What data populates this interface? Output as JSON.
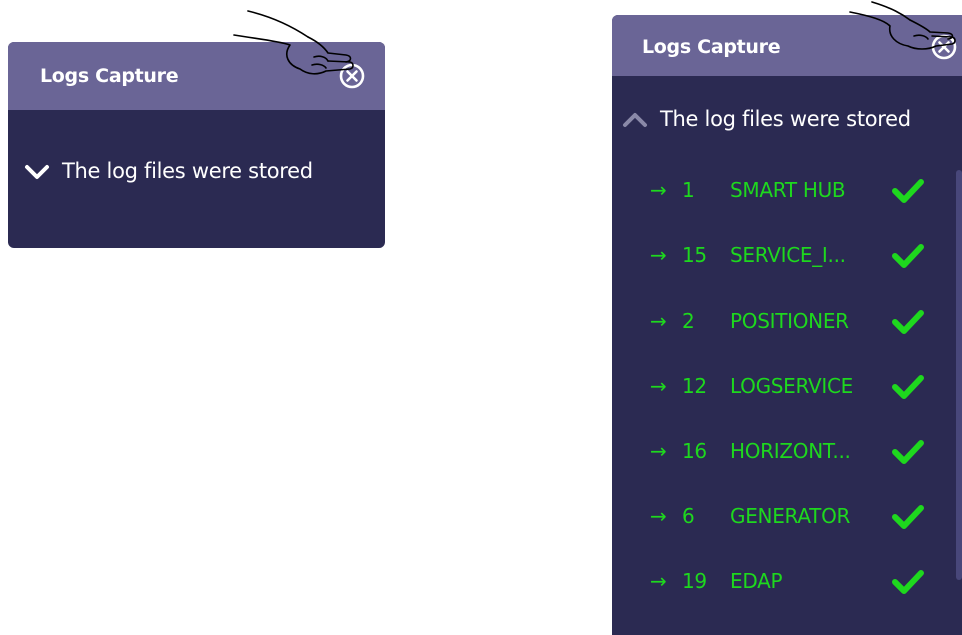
{
  "left_dialog": {
    "title": "Logs Capture",
    "close_icon": "close-circle-icon",
    "status_text": "The log files were stored",
    "chevron": "chevron-down-icon"
  },
  "right_dialog": {
    "title": "Logs Capture",
    "close_icon": "close-circle-icon",
    "status_text": "The log files were stored",
    "chevron": "chevron-up-icon",
    "logs": [
      {
        "arrow": "→",
        "id": "1",
        "name": "SMART HUB",
        "status_icon": "check-icon"
      },
      {
        "arrow": "→",
        "id": "15",
        "name": "SERVICE_I...",
        "status_icon": "check-icon"
      },
      {
        "arrow": "→",
        "id": "2",
        "name": "POSITIONER",
        "status_icon": "check-icon"
      },
      {
        "arrow": "→",
        "id": "12",
        "name": "LOGSERVICE",
        "status_icon": "check-icon"
      },
      {
        "arrow": "→",
        "id": "16",
        "name": "HORIZONT...",
        "status_icon": "check-icon"
      },
      {
        "arrow": "→",
        "id": "6",
        "name": "GENERATOR",
        "status_icon": "check-icon"
      },
      {
        "arrow": "→",
        "id": "19",
        "name": "EDAP",
        "status_icon": "check-icon"
      }
    ]
  },
  "colors": {
    "header_bg": "#6a6596",
    "panel_bg": "#2b2a52",
    "log_text": "#1ed81e",
    "check": "#1ed81e"
  }
}
